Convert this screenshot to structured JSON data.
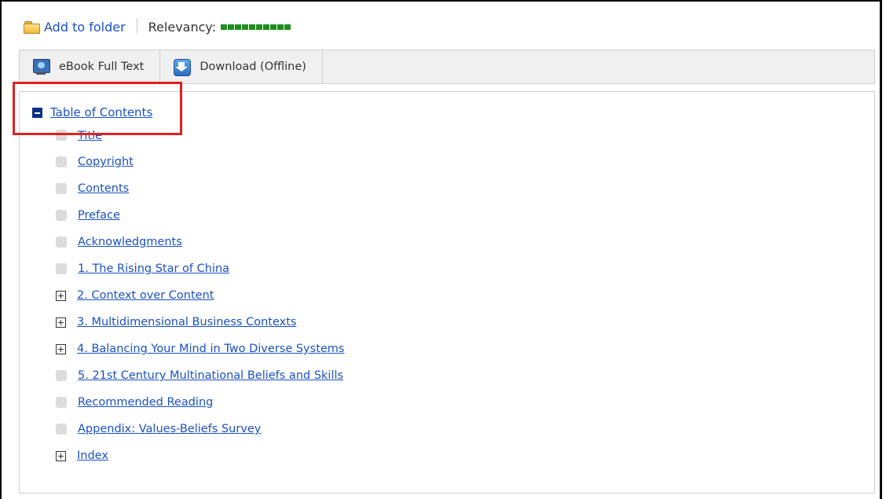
{
  "topbar": {
    "add_to_folder": "Add to folder",
    "relevancy_label": "Relevancy:",
    "relevancy_blocks": 10
  },
  "toolbar": {
    "ebook_full_text": "eBook Full Text",
    "download_offline": "Download (Offline)"
  },
  "toc": {
    "heading": "Table of Contents",
    "items": [
      {
        "label": "Title",
        "expandable": false
      },
      {
        "label": "Copyright",
        "expandable": false
      },
      {
        "label": "Contents",
        "expandable": false
      },
      {
        "label": "Preface",
        "expandable": false
      },
      {
        "label": "Acknowledgments",
        "expandable": false
      },
      {
        "label": "1. The Rising Star of China",
        "expandable": false
      },
      {
        "label": "2. Context over Content",
        "expandable": true
      },
      {
        "label": "3. Multidimensional Business Contexts",
        "expandable": true
      },
      {
        "label": "4. Balancing Your Mind in Two Diverse Systems",
        "expandable": true
      },
      {
        "label": "5. 21st Century Multinational Beliefs and Skills",
        "expandable": false
      },
      {
        "label": "Recommended Reading",
        "expandable": false
      },
      {
        "label": "Appendix: Values-Beliefs Survey",
        "expandable": false
      },
      {
        "label": "Index",
        "expandable": true
      }
    ]
  },
  "colors": {
    "link": "#1a52c4",
    "relevancy": "#1e8f1e",
    "highlight": "#e02020",
    "toc_toggle": "#0b2f8a"
  },
  "icons": {
    "folder": "folder-icon",
    "ebook": "ebook-monitor-icon",
    "download": "download-arrow-icon"
  }
}
